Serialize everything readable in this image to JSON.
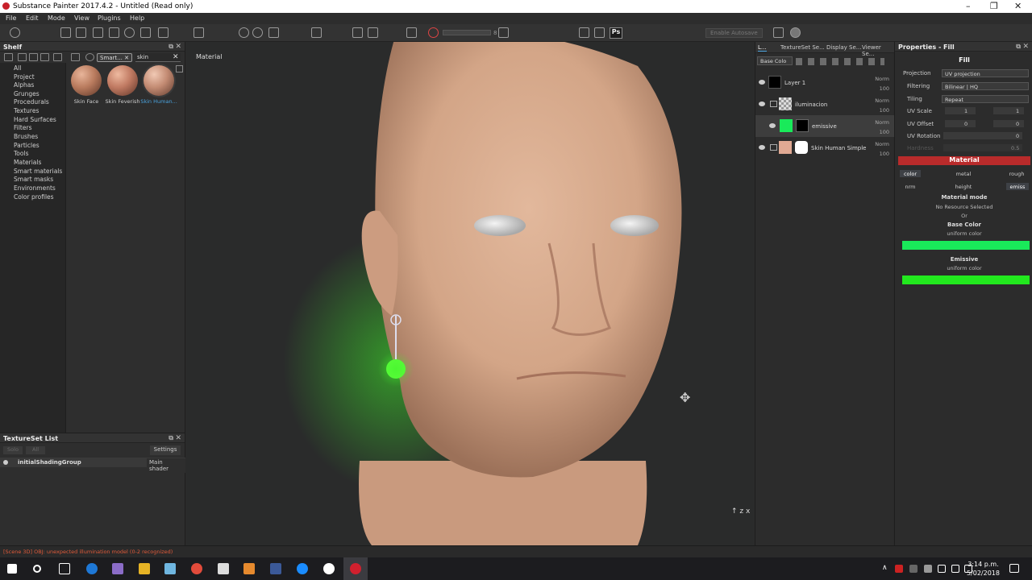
{
  "window": {
    "title": "Substance Painter 2017.4.2 - Untitled (Read only)"
  },
  "menu": [
    "File",
    "Edit",
    "Mode",
    "View",
    "Plugins",
    "Help"
  ],
  "toolbar": {
    "autosave_label": "Enable Autosave",
    "brush_size": "8",
    "ps_label": "Ps"
  },
  "shelf": {
    "title": "Shelf",
    "tag_label": "Smart...",
    "search_value": "skin",
    "categories": [
      "All",
      "Project",
      "Alphas",
      "Grunges",
      "Procedurals",
      "Textures",
      "Hard Surfaces",
      "Filters",
      "Brushes",
      "Particles",
      "Tools",
      "Materials",
      "Smart materials",
      "Smart masks",
      "Environments",
      "Color profiles"
    ],
    "items": [
      {
        "label": "Skin Face",
        "selected": false
      },
      {
        "label": "Skin Feverish",
        "selected": false
      },
      {
        "label": "Skin Human...",
        "selected": true
      }
    ]
  },
  "textureset_list": {
    "title": "TextureSet List",
    "btn_solo": "Solo",
    "btn_all": "All",
    "settings_label": "Settings",
    "row_name": "initialShadingGroup",
    "row_shader": "Main shader"
  },
  "viewport": {
    "label": "Material"
  },
  "layers": {
    "tabs": [
      "L...",
      "TextureSet Se...",
      "Display Se...",
      "Viewer Se..."
    ],
    "channel_select": "Base Colo",
    "rows": [
      {
        "name": "Layer 1",
        "blend": "Norm",
        "opacity": "100"
      },
      {
        "name": "iluminacion",
        "blend": "Norm",
        "opacity": "100"
      },
      {
        "name": "emissive",
        "blend": "Norm",
        "opacity": "100"
      },
      {
        "name": "Skin Human Simple",
        "blend": "Norm",
        "opacity": "100"
      }
    ]
  },
  "properties": {
    "title": "Properties - Fill",
    "fill_section": "Fill",
    "projection_label": "Projection",
    "projection_value": "UV projection",
    "filtering_label": "Filtering",
    "filtering_value": "Bilinear | HQ",
    "tiling_label": "Tiling",
    "tiling_value": "Repeat",
    "uv_scale_label": "UV Scale",
    "uv_scale_a": "1",
    "uv_scale_b": "1",
    "uv_offset_label": "UV Offset",
    "uv_offset_a": "0",
    "uv_offset_b": "0",
    "uv_rotation_label": "UV Rotation",
    "uv_rotation_value": "0",
    "hardness_label": "Hardness",
    "hardness_value": "0.5",
    "material_section": "Material",
    "channels": [
      "color",
      "metal",
      "rough",
      "nrm",
      "height",
      "emiss"
    ],
    "material_mode_label": "Material mode",
    "material_mode_value": "No Resource Selected",
    "or_label": "Or",
    "base_color_label": "Base Color",
    "base_color_sub": "uniform color",
    "base_color": "#19ea5a",
    "emissive_label": "Emissive",
    "emissive_sub": "uniform color",
    "emissive_color": "#22e81e"
  },
  "status": {
    "message": "[Scene 3D] OBJ: unexpected illumination model (0-2 recognized)"
  },
  "taskbar": {
    "time": "3:14 p.m.",
    "date": "5/02/2018"
  }
}
